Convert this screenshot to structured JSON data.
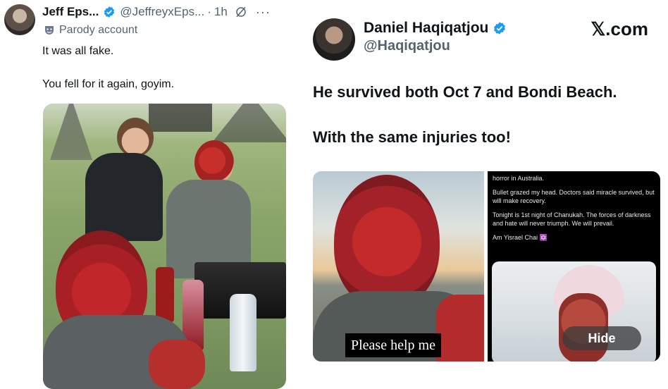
{
  "left_tweet": {
    "author_name": "Jeff Eps...",
    "handle": "@JeffreyxEps...",
    "separator": "·",
    "time": "1h",
    "more": "···",
    "badge": "Parody account",
    "text_line1": "It was all fake.",
    "text_line2": "You fell for it again, goyim."
  },
  "right_post": {
    "author_name": "Daniel Haqiqatjou",
    "handle": "@Haqiqatjou",
    "watermark": "𝕏.com",
    "headline1": "He survived both Oct 7 and Bondi Beach.",
    "headline2": "With the same injuries too!",
    "photo_caption": "Please help me",
    "panel_lines": [
      "horror in Australia.",
      "Bullet grazed my head. Doctors said miracle survived, but will make recovery.",
      "Tonight is 1st night of Chanukah. The forces of darkness and hate will never triumph. We will prevail.",
      "Am Yisrael Chai ✡️"
    ],
    "hide_button": "Hide"
  },
  "colors": {
    "verified_blue": "#1d9bf0",
    "secondary_text": "#536471",
    "primary_text": "#0f1419"
  }
}
